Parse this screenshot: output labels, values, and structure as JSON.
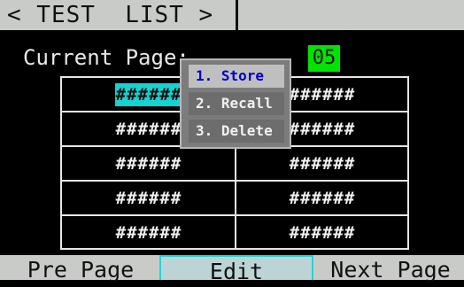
{
  "header": {
    "title": "< TEST  LIST >"
  },
  "status": {
    "label": "Current Page:",
    "page": "05"
  },
  "grid": {
    "rows": [
      [
        "######",
        "######"
      ],
      [
        "######",
        "######"
      ],
      [
        "######",
        "######"
      ],
      [
        "######",
        "######"
      ],
      [
        "######",
        "######"
      ]
    ],
    "selected_cell": "row1-col1"
  },
  "popup_menu": {
    "items": [
      "1. Store",
      "2. Recall",
      "3. Delete"
    ],
    "selected_index": 0
  },
  "softkeys": {
    "prev": "Pre Page",
    "edit": "Edit",
    "next": "Next Page"
  },
  "colors": {
    "bar_gray": "#c9cbc8",
    "page_box_green": "#00e400",
    "highlight_cyan": "#16d2d2",
    "menu_selected_text": "#0000c8"
  }
}
